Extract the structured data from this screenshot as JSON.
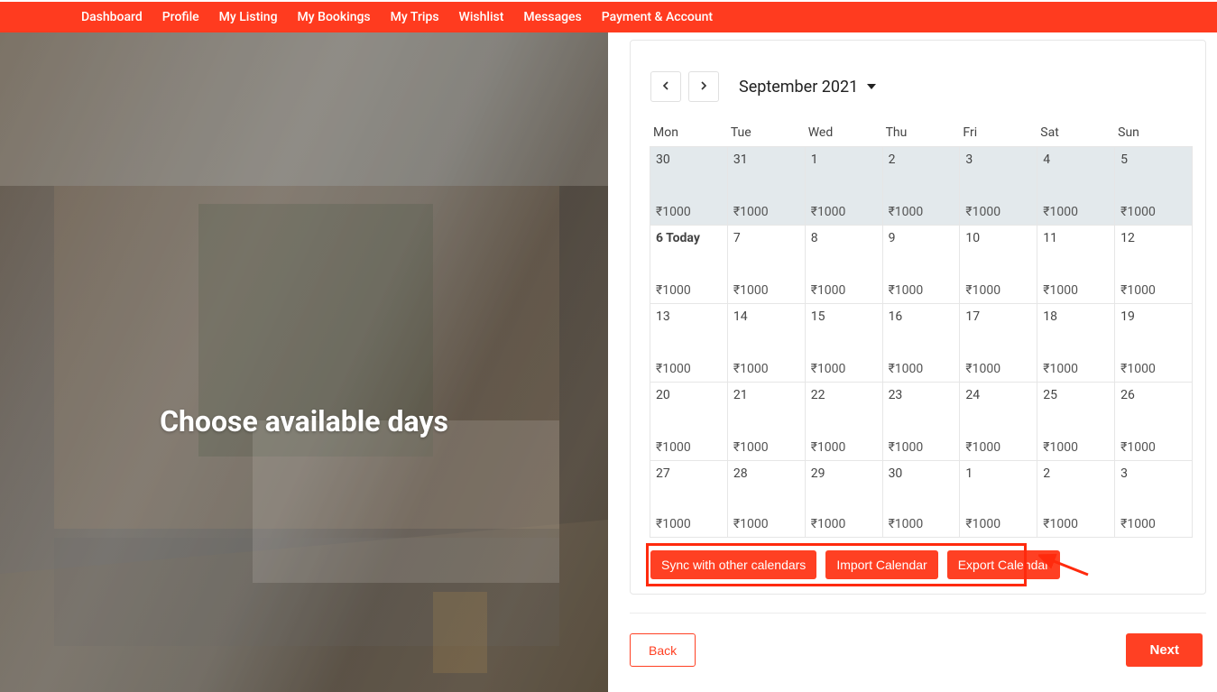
{
  "nav": [
    "Dashboard",
    "Profile",
    "My Listing",
    "My Bookings",
    "My Trips",
    "Wishlist",
    "Messages",
    "Payment & Account"
  ],
  "leftPanel": {
    "heading": "Choose available days"
  },
  "calendar": {
    "monthLabel": "September 2021",
    "dayHeaders": [
      "Mon",
      "Tue",
      "Wed",
      "Thu",
      "Fri",
      "Sat",
      "Sun"
    ],
    "price": "₹1000",
    "weeks": [
      [
        {
          "num": "30",
          "muted": true
        },
        {
          "num": "31",
          "muted": true
        },
        {
          "num": "1",
          "muted": true
        },
        {
          "num": "2",
          "muted": true
        },
        {
          "num": "3",
          "muted": true
        },
        {
          "num": "4",
          "muted": true
        },
        {
          "num": "5",
          "muted": true
        }
      ],
      [
        {
          "num": "6 Today",
          "today": true
        },
        {
          "num": "7"
        },
        {
          "num": "8"
        },
        {
          "num": "9"
        },
        {
          "num": "10"
        },
        {
          "num": "11"
        },
        {
          "num": "12"
        }
      ],
      [
        {
          "num": "13"
        },
        {
          "num": "14"
        },
        {
          "num": "15"
        },
        {
          "num": "16"
        },
        {
          "num": "17"
        },
        {
          "num": "18"
        },
        {
          "num": "19"
        }
      ],
      [
        {
          "num": "20"
        },
        {
          "num": "21"
        },
        {
          "num": "22"
        },
        {
          "num": "23"
        },
        {
          "num": "24"
        },
        {
          "num": "25"
        },
        {
          "num": "26"
        }
      ],
      [
        {
          "num": "27"
        },
        {
          "num": "28"
        },
        {
          "num": "29"
        },
        {
          "num": "30"
        },
        {
          "num": "1"
        },
        {
          "num": "2"
        },
        {
          "num": "3"
        }
      ]
    ]
  },
  "buttons": {
    "sync": "Sync with other calendars",
    "import": "Import Calendar",
    "export": "Export Calendar",
    "back": "Back",
    "next": "Next"
  },
  "colors": {
    "primary": "#ff4023",
    "muted_cell": "#e3e9ec"
  }
}
